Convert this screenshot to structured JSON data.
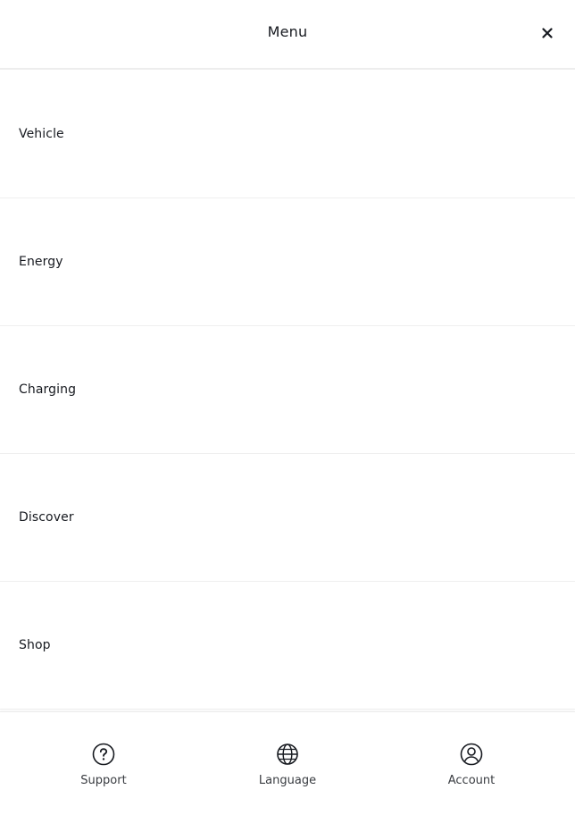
{
  "header": {
    "title": "Menu",
    "close_icon": "close-icon"
  },
  "menu": {
    "items": [
      {
        "label": "Vehicle"
      },
      {
        "label": "Energy"
      },
      {
        "label": "Charging"
      },
      {
        "label": "Discover"
      },
      {
        "label": "Shop"
      }
    ]
  },
  "footer": {
    "support": {
      "label": "Support",
      "icon": "question-circle-icon"
    },
    "language": {
      "label": "Language",
      "icon": "globe-icon"
    },
    "account": {
      "label": "Account",
      "icon": "user-circle-icon"
    }
  },
  "colors": {
    "text": "#171a20",
    "divider": "#efefef",
    "background": "#ffffff"
  }
}
